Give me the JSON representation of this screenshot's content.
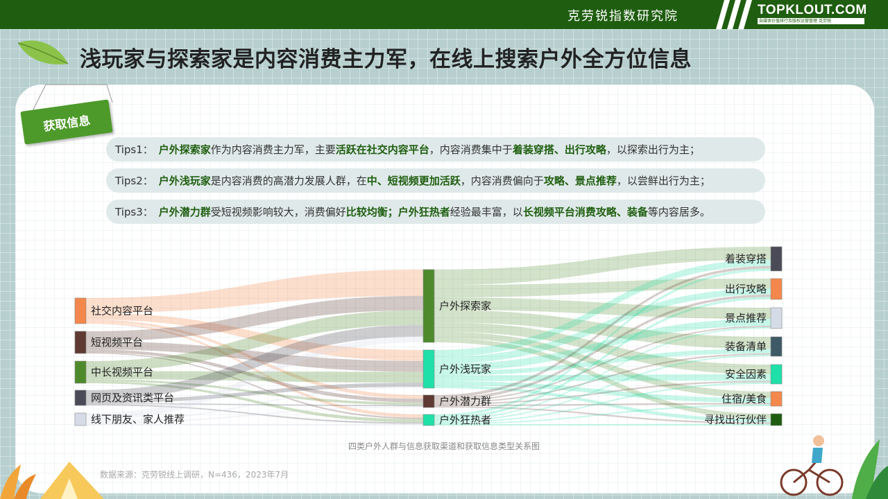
{
  "header": {
    "institute": "克劳锐指数研究院",
    "logo": "TOPKLOUT.COM",
    "logo_tagline": "自媒体价值排行及版权运营管理",
    "logo_cn": "克劳锐"
  },
  "page_title": "浅玩家与探索家是内容消费主力军，在线上搜索户外全方位信息",
  "section_tag": "获取信息",
  "tips": [
    {
      "label": "Tips1：",
      "parts": [
        {
          "t": "户外探索家",
          "b": true
        },
        {
          "t": "作为内容消费主力军，主要",
          "b": false
        },
        {
          "t": "活跃在社交内容平台",
          "b": true
        },
        {
          "t": "，内容消费集中于",
          "b": false
        },
        {
          "t": "着装穿搭、出行攻略",
          "b": true
        },
        {
          "t": "，以探索出行为主；",
          "b": false
        }
      ]
    },
    {
      "label": "Tips2：",
      "parts": [
        {
          "t": "户外浅玩家",
          "b": true
        },
        {
          "t": "是内容消费的高潜力发展人群，在",
          "b": false
        },
        {
          "t": "中、短视频更加活跃",
          "b": true
        },
        {
          "t": "，内容消费偏向于",
          "b": false
        },
        {
          "t": "攻略、景点推荐",
          "b": true
        },
        {
          "t": "，以尝鲜出行为主；",
          "b": false
        }
      ]
    },
    {
      "label": "Tips3：",
      "parts": [
        {
          "t": "户外潜力群",
          "b": true
        },
        {
          "t": "受短视频影响较大，消费偏好",
          "b": false
        },
        {
          "t": "比较均衡；户外狂热者",
          "b": true
        },
        {
          "t": "经验最丰富，以",
          "b": false
        },
        {
          "t": "长视频平台消费攻略、装备",
          "b": true
        },
        {
          "t": "等内容居多。",
          "b": false
        }
      ]
    }
  ],
  "chart_data": {
    "type": "sankey",
    "left_nodes": [
      {
        "name": "社交内容平台",
        "color": "#f4874b"
      },
      {
        "name": "短视频平台",
        "color": "#5e3a33"
      },
      {
        "name": "中长视频平台",
        "color": "#4e8a2c"
      },
      {
        "name": "网页及资讯类平台",
        "color": "#4b4b57"
      },
      {
        "name": "线下朋友、家人推荐",
        "color": "#d6dbe8"
      }
    ],
    "middle_nodes": [
      {
        "name": "户外探索家",
        "color": "#4e8a2c"
      },
      {
        "name": "户外浅玩家",
        "color": "#1fe0a8"
      },
      {
        "name": "户外潜力群",
        "color": "#5e3a33"
      },
      {
        "name": "户外狂热者",
        "color": "#1fe0a8"
      }
    ],
    "right_nodes": [
      {
        "name": "着装穿搭",
        "color": "#4b4b57"
      },
      {
        "name": "出行攻略",
        "color": "#f4874b"
      },
      {
        "name": "景点推荐",
        "color": "#d6dbe8"
      },
      {
        "name": "装备清单",
        "color": "#3e5a66"
      },
      {
        "name": "安全因素",
        "color": "#1fe0a8"
      },
      {
        "name": "住宿/美食",
        "color": "#f4874b"
      },
      {
        "name": "寻找出行伙伴",
        "color": "#1f5e10"
      }
    ],
    "links_left": [
      [
        0,
        0,
        18
      ],
      [
        0,
        1,
        8
      ],
      [
        0,
        2,
        3
      ],
      [
        0,
        3,
        2
      ],
      [
        1,
        0,
        10
      ],
      [
        1,
        1,
        8
      ],
      [
        1,
        2,
        3
      ],
      [
        1,
        3,
        1
      ],
      [
        2,
        0,
        10
      ],
      [
        2,
        1,
        8
      ],
      [
        2,
        2,
        2
      ],
      [
        2,
        3,
        2
      ],
      [
        3,
        0,
        8
      ],
      [
        3,
        1,
        3
      ],
      [
        3,
        2,
        1
      ],
      [
        3,
        3,
        1
      ],
      [
        4,
        0,
        4
      ],
      [
        4,
        1,
        1
      ],
      [
        4,
        2,
        1
      ],
      [
        4,
        3,
        1
      ]
    ],
    "links_right": [
      [
        0,
        0,
        10
      ],
      [
        0,
        1,
        8
      ],
      [
        0,
        2,
        8
      ],
      [
        0,
        3,
        8
      ],
      [
        0,
        4,
        6
      ],
      [
        0,
        5,
        4
      ],
      [
        0,
        6,
        3
      ],
      [
        1,
        0,
        5
      ],
      [
        1,
        1,
        5
      ],
      [
        1,
        2,
        5
      ],
      [
        1,
        3,
        3
      ],
      [
        1,
        4,
        4
      ],
      [
        1,
        5,
        3
      ],
      [
        1,
        6,
        2
      ],
      [
        2,
        0,
        2
      ],
      [
        2,
        1,
        2
      ],
      [
        2,
        2,
        1
      ],
      [
        2,
        3,
        1
      ],
      [
        2,
        4,
        1
      ],
      [
        2,
        5,
        1
      ],
      [
        2,
        6,
        1
      ],
      [
        3,
        0,
        2
      ],
      [
        3,
        1,
        2
      ],
      [
        3,
        2,
        1
      ],
      [
        3,
        3,
        1
      ],
      [
        3,
        4,
        1
      ],
      [
        3,
        5,
        1
      ],
      [
        3,
        6,
        1
      ]
    ]
  },
  "caption": "四类户外人群与信息获取渠道和获取信息类型关系图",
  "source": "数据来源：克劳锐线上调研，N=436，2023年7月"
}
